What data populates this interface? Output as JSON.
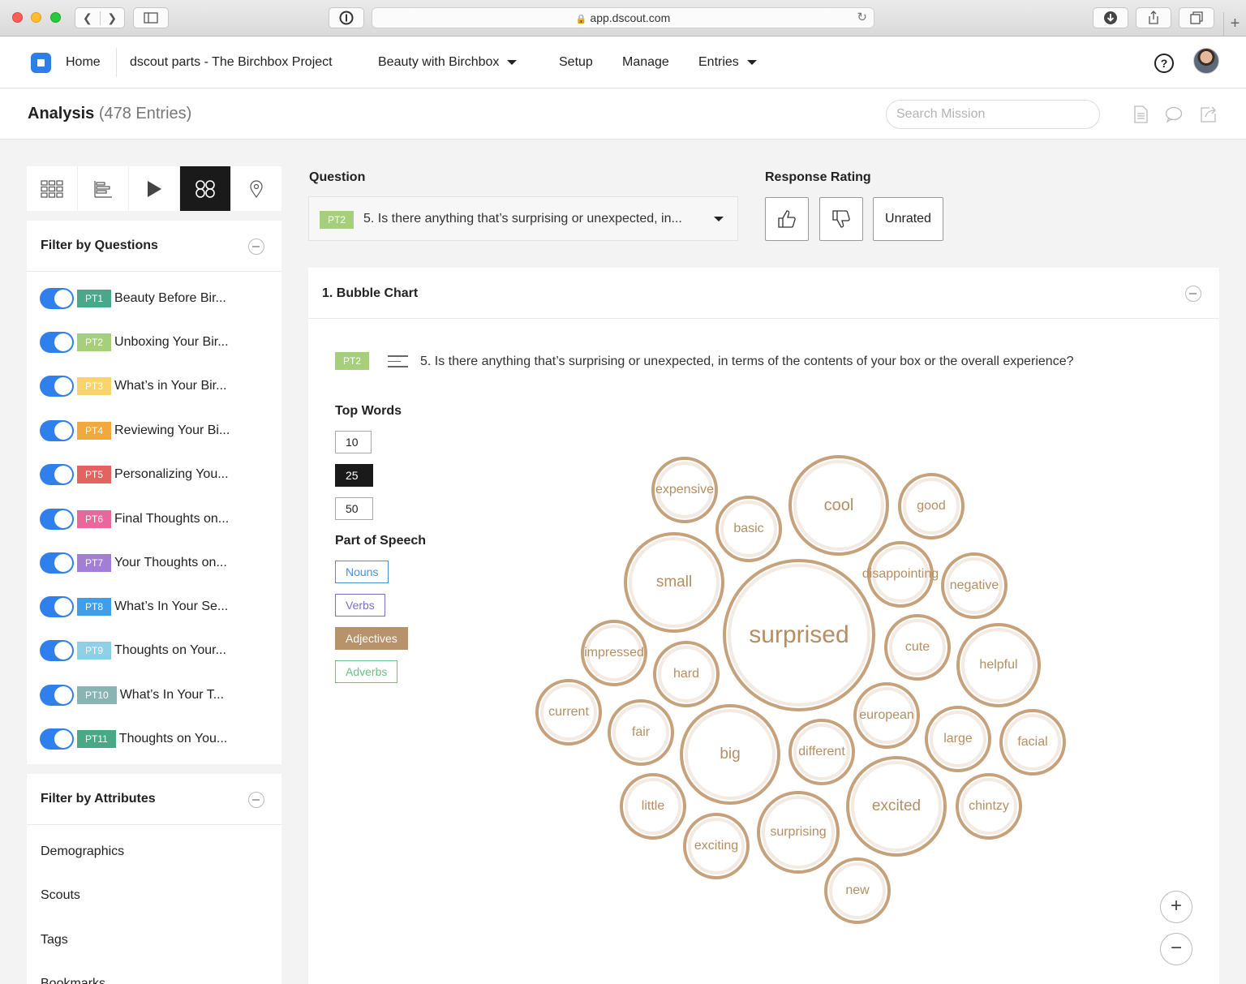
{
  "browser": {
    "url": "app.dscout.com"
  },
  "header": {
    "nav": {
      "home": "Home",
      "project": "dscout parts - The Birchbox Project",
      "mission": "Beauty with Birchbox",
      "setup": "Setup",
      "manage": "Manage",
      "entries": "Entries"
    },
    "help": "?"
  },
  "analysis": {
    "title": "Analysis",
    "count": "(478 Entries)",
    "search_placeholder": "Search Mission"
  },
  "sidebar": {
    "filter_questions_title": "Filter by Questions",
    "questions": [
      {
        "badge": "PT1",
        "label": "Beauty Before Bir...",
        "color": "#4aa88a"
      },
      {
        "badge": "PT2",
        "label": "Unboxing Your Bir...",
        "color": "#a6cf7a"
      },
      {
        "badge": "PT3",
        "label": "What’s in Your Bir...",
        "color": "#f9d36b"
      },
      {
        "badge": "PT4",
        "label": "Reviewing Your Bi...",
        "color": "#f3a83b"
      },
      {
        "badge": "PT5",
        "label": "Personalizing You...",
        "color": "#e3645f"
      },
      {
        "badge": "PT6",
        "label": "Final Thoughts on...",
        "color": "#e9679a"
      },
      {
        "badge": "PT7",
        "label": "Your Thoughts on...",
        "color": "#a27ed6"
      },
      {
        "badge": "PT8",
        "label": "What’s In Your Se...",
        "color": "#3e9ee9"
      },
      {
        "badge": "PT9",
        "label": "Thoughts on Your...",
        "color": "#8ed0e8"
      },
      {
        "badge": "PT10",
        "label": "What’s In Your T...",
        "color": "#88b5b4"
      },
      {
        "badge": "PT11",
        "label": "Thoughts on You...",
        "color": "#47a985"
      }
    ],
    "filter_attributes_title": "Filter by Attributes",
    "attributes": [
      "Demographics",
      "Scouts",
      "Tags",
      "Bookmarks"
    ]
  },
  "main": {
    "question_label": "Question",
    "selected_badge": "PT2",
    "selected_question": "5. Is there anything that’s surprising or unexpected, in...",
    "rating_label": "Response Rating",
    "unrated": "Unrated",
    "chart_title": "1. Bubble Chart",
    "chart_badge": "PT2",
    "chart_question": "5. Is there anything that’s surprising or unexpected, in terms of the contents of your box or the overall experience?",
    "top_words_label": "Top Words",
    "top_words_options": [
      "10",
      "25",
      "50"
    ],
    "top_words_selected": "25",
    "pos_label": "Part of Speech",
    "pos_options": [
      {
        "label": "Nouns",
        "color": "#4a90d9",
        "selected": false
      },
      {
        "label": "Verbs",
        "color": "#7a6fc4",
        "selected": false
      },
      {
        "label": "Adjectives",
        "color": "#b8926a",
        "selected": true
      },
      {
        "label": "Adverbs",
        "color": "#6ac08a",
        "selected": false
      }
    ],
    "zoom_in": "+",
    "zoom_out": "−"
  },
  "chart_data": {
    "type": "bubble",
    "words": [
      "surprised",
      "cool",
      "small",
      "big",
      "excited",
      "helpful",
      "expensive",
      "good",
      "basic",
      "disappointing",
      "negative",
      "impressed",
      "cute",
      "hard",
      "current",
      "european",
      "fair",
      "different",
      "large",
      "facial",
      "little",
      "chintzy",
      "surprising",
      "exciting",
      "new"
    ]
  }
}
